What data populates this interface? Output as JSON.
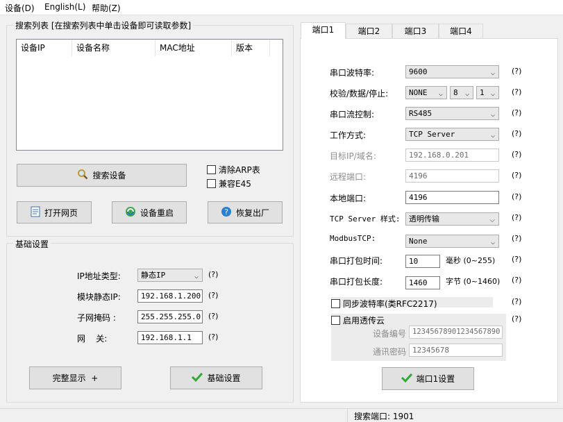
{
  "menu": {
    "device": "设备(D)",
    "english": "English(L)",
    "help": "帮助(Z)"
  },
  "search_group": {
    "title": "搜索列表 [在搜索列表中单击设备即可读取参数]",
    "columns": [
      "设备IP",
      "设备名称",
      "MAC地址",
      "版本"
    ],
    "search_button": "搜索设备",
    "clear_arp": "清除ARP表",
    "compat_e45": "兼容E45",
    "open_web": "打开网页",
    "restart": "设备重启",
    "factory_reset": "恢复出厂"
  },
  "basic_group": {
    "title": "基础设置",
    "ip_type_label": "IP地址类型:",
    "ip_type_value": "静态IP",
    "static_ip_label": "模块静态IP:",
    "static_ip_value": "192.168.1.200",
    "subnet_label": "子网掩码 :",
    "subnet_value": "255.255.255.0",
    "gateway_label": "网    关:",
    "gateway_value": "192.168.1.1",
    "help": "(?)",
    "full_display": "完整显示  +",
    "basic_settings_button": "基础设置"
  },
  "tabs": [
    "端口1",
    "端口2",
    "端口3",
    "端口4"
  ],
  "port": {
    "baud_label": "串口波特率:",
    "baud_value": "9600",
    "parity_label": "校验/数据/停止:",
    "parity_value": "NONE",
    "data_bits": "8",
    "stop_bits": "1",
    "flow_label": "串口流控制:",
    "flow_value": "RS485",
    "mode_label": "工作方式:",
    "mode_value": "TCP Server",
    "target_label": "目标IP/域名:",
    "target_value": "192.168.0.201",
    "remote_port_label": "远程端口:",
    "remote_port_value": "4196",
    "local_port_label": "本地端口:",
    "local_port_value": "4196",
    "tcp_style_label": "TCP Server 样式:",
    "tcp_style_value": "透明传输",
    "modbus_label": "ModbusTCP:",
    "modbus_value": "None",
    "pack_time_label": "串口打包时间:",
    "pack_time_value": "10",
    "pack_time_unit": "毫秒 (0~255)",
    "pack_len_label": "串口打包长度:",
    "pack_len_value": "1460",
    "pack_len_unit": "字节 (0~1460)",
    "sync_baud": "同步波特率(类RFC2217)",
    "cloud_enable": "启用透传云",
    "device_no_label": "设备编号",
    "device_no_value": "12345678901234567890",
    "comm_pwd_label": "通讯密码",
    "comm_pwd_value": "12345678",
    "help": "(?)",
    "port_settings_button": "端口1设置"
  },
  "status": {
    "search_port": "搜索端口: 1901"
  },
  "colors": {
    "accent_check": "#2eaa35",
    "search_icon": "#c49a2a",
    "help_icon": "#2a7fd4"
  }
}
